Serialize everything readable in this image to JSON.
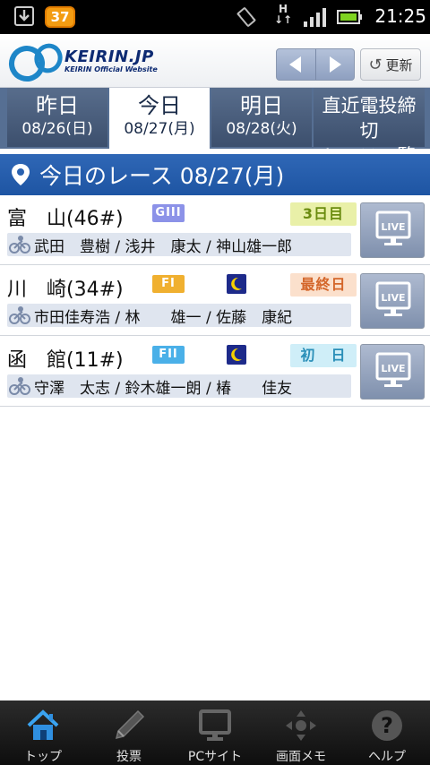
{
  "status_bar": {
    "notification_count": "37",
    "network": "H",
    "time": "21:25"
  },
  "header": {
    "logo_text": "KEIRIN.JP",
    "logo_subtext": "KEIRIN Official Website",
    "refresh_label": "更新"
  },
  "tabs": [
    {
      "label": "昨日",
      "sub": "08/26(日)"
    },
    {
      "label": "今日",
      "sub": "08/27(月)"
    },
    {
      "label": "明日",
      "sub": "08/28(火)"
    },
    {
      "label": "直近電投締切",
      "sub": "レース一覧"
    }
  ],
  "section_title": "今日のレース 08/27(月)",
  "races": [
    {
      "venue": "富　山(46#)",
      "grade": "GIII",
      "grade_color": "#8c92e8",
      "night": false,
      "day_label": "3日目",
      "day_bg": "#e9f0a8",
      "day_fg": "#6b8c10",
      "riders": "武田　豊樹 / 浅井　康太 / 神山雄一郎",
      "live": "LIVE"
    },
    {
      "venue": "川　崎(34#)",
      "grade": "FI",
      "grade_color": "#f0b030",
      "night": true,
      "day_label": "最終日",
      "day_bg": "#fbe0cc",
      "day_fg": "#d4662a",
      "riders": "市田佳寿浩 / 林　　雄一 / 佐藤　康紀",
      "live": "LIVE"
    },
    {
      "venue": "函　館(11#)",
      "grade": "FII",
      "grade_color": "#4ab0e8",
      "night": true,
      "day_label": "初　日",
      "day_bg": "#cfeef8",
      "day_fg": "#2a8fb8",
      "riders": "守澤　太志 / 鈴木雄一朗 / 椿　　佳友",
      "live": "LIVE"
    }
  ],
  "bottom_nav": [
    {
      "label": "トップ",
      "icon": "home-icon"
    },
    {
      "label": "投票",
      "icon": "pen-icon"
    },
    {
      "label": "PCサイト",
      "icon": "monitor-icon"
    },
    {
      "label": "画面メモ",
      "icon": "move-icon"
    },
    {
      "label": "ヘルプ",
      "icon": "help-icon"
    }
  ]
}
